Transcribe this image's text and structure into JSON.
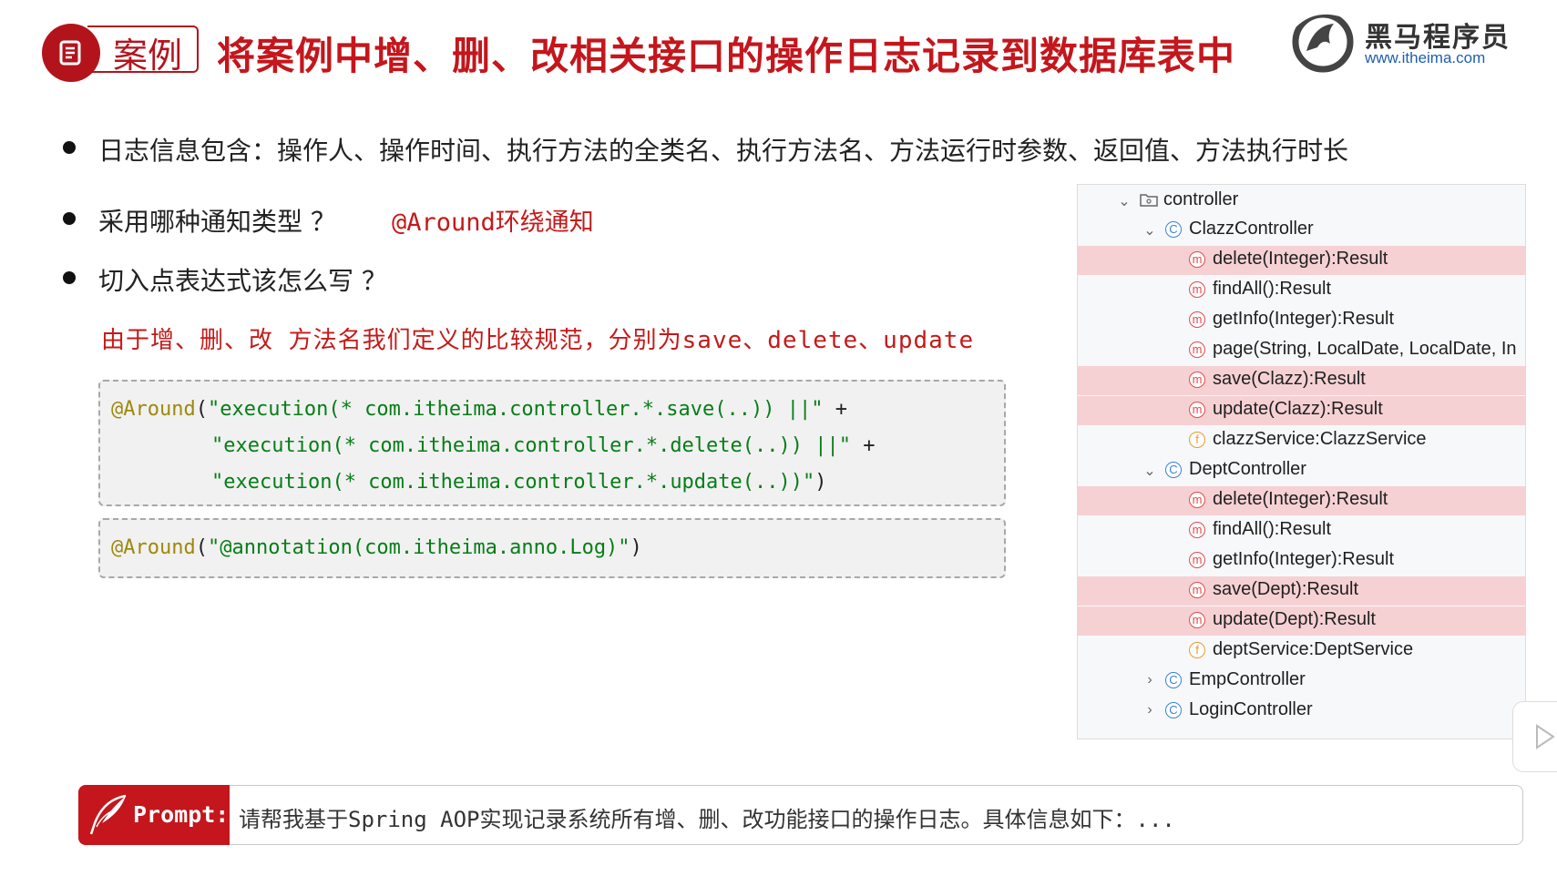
{
  "header": {
    "badge_label": "案例",
    "title": "将案例中增、删、改相关接口的操作日志记录到数据库表中",
    "logo_cn": "黑马程序员",
    "logo_url": "www.itheima.com"
  },
  "bullets": [
    {
      "text": "日志信息包含：操作人、操作时间、执行方法的全类名、执行方法名、方法运行时参数、返回值、方法执行时长"
    },
    {
      "text": "采用哪种通知类型 ？",
      "answer": "@Around环绕通知"
    },
    {
      "text": "切入点表达式该怎么写 ？"
    }
  ],
  "note": "由于增、删、改 方法名我们定义的比较规范，分别为save、delete、update",
  "code1": {
    "anno": "@Around",
    "lines": [
      {
        "open": "(",
        "str": "\"execution(* com.itheima.controller.*.save(..)) ||\"",
        "tail": " +"
      },
      {
        "open": "",
        "str": "\"execution(* com.itheima.controller.*.delete(..)) ||\"",
        "tail": " +"
      },
      {
        "open": "",
        "str": "\"execution(* com.itheima.controller.*.update(..))\"",
        "tail": ")"
      }
    ]
  },
  "code2": {
    "anno": "@Around",
    "open": "(",
    "str": "\"@annotation(com.itheima.anno.Log)\"",
    "close": ")"
  },
  "tree": {
    "rows": [
      {
        "label": "controller"
      },
      {
        "label": "ClazzController"
      },
      {
        "label": "delete(Integer):Result"
      },
      {
        "label": "findAll():Result"
      },
      {
        "label": "getInfo(Integer):Result"
      },
      {
        "label": "page(String, LocalDate, LocalDate, In"
      },
      {
        "label": "save(Clazz):Result"
      },
      {
        "label": "update(Clazz):Result"
      },
      {
        "label": "clazzService:ClazzService"
      },
      {
        "label": "DeptController"
      },
      {
        "label": "delete(Integer):Result"
      },
      {
        "label": "findAll():Result"
      },
      {
        "label": "getInfo(Integer):Result"
      },
      {
        "label": "save(Dept):Result"
      },
      {
        "label": "update(Dept):Result"
      },
      {
        "label": "deptService:DeptService"
      },
      {
        "label": "EmpController"
      },
      {
        "label": "LoginController"
      }
    ],
    "icon_letters": {
      "method": "m",
      "class": "C",
      "field": "f"
    },
    "highlight_color": "#f6d1d4"
  },
  "prompt": {
    "label": "Prompt:",
    "text": "请帮我基于Spring AOP实现记录系统所有增、删、改功能接口的操作日志。具体信息如下：..."
  },
  "colors": {
    "brand_red": "#c4161c",
    "annotation": "#9e880d",
    "string": "#067d17"
  }
}
